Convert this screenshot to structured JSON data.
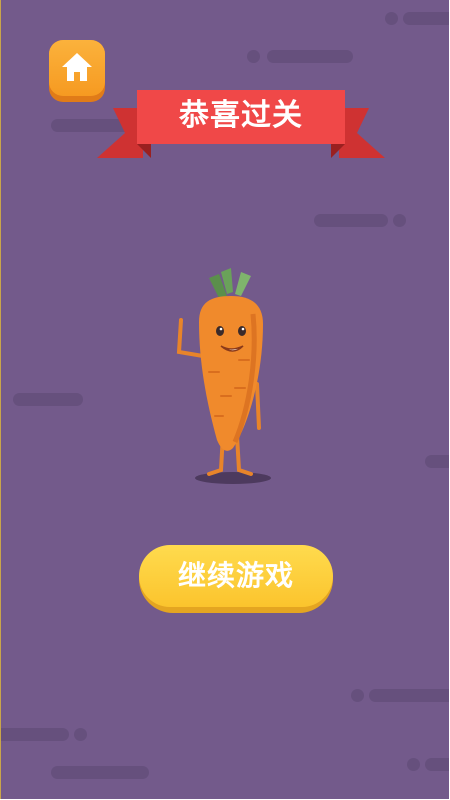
{
  "scene": {
    "title": "恭喜过关",
    "continue_label": "继续游戏"
  },
  "icons": {
    "home": "home-icon",
    "character": "carrot-character"
  },
  "colors": {
    "background": "#735a8b",
    "ribbon": "#f04848",
    "home_button": "#f69a21",
    "continue_button": "#fbc42d",
    "carrot": "#f08a2c"
  }
}
